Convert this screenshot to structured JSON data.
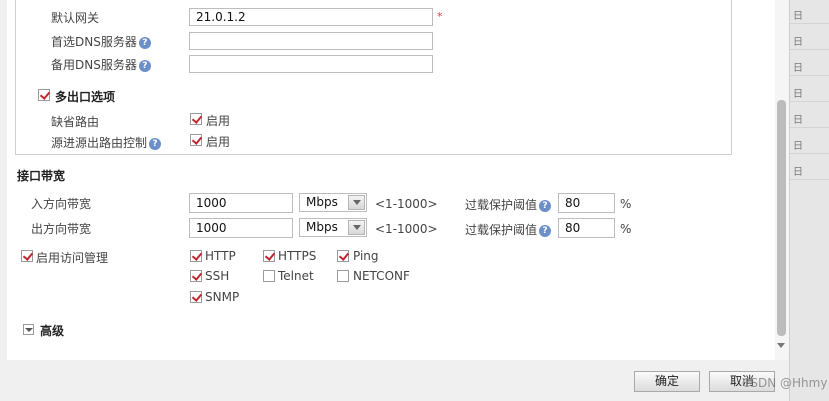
{
  "gateway": {
    "label": "默认网关",
    "value": "21.0.1.2",
    "required_mark": "*"
  },
  "dns_primary": {
    "label": "首选DNS服务器",
    "value": ""
  },
  "dns_secondary": {
    "label": "备用DNS服务器",
    "value": ""
  },
  "help_glyph": "?",
  "multi_egress": {
    "label": "多出口选项",
    "checked": true,
    "default_route": {
      "label": "缺省路由",
      "option": "启用",
      "checked": true
    },
    "source_route": {
      "label": "源进源出路由控制",
      "option": "启用",
      "checked": true
    }
  },
  "bandwidth": {
    "title": "接口带宽",
    "inbound": {
      "label": "入方向带宽",
      "value": "1000",
      "unit": "Mbps",
      "range": "<1-1000>",
      "threshold_label": "过载保护阈值",
      "threshold": "80",
      "percent": "%"
    },
    "outbound": {
      "label": "出方向带宽",
      "value": "1000",
      "unit": "Mbps",
      "range": "<1-1000>",
      "threshold_label": "过载保护阈值",
      "threshold": "80",
      "percent": "%"
    }
  },
  "access_mgmt": {
    "label": "启用访问管理",
    "checked": true,
    "protocols": [
      {
        "name": "HTTP",
        "checked": true
      },
      {
        "name": "HTTPS",
        "checked": true
      },
      {
        "name": "Ping",
        "checked": true
      },
      {
        "name": "SSH",
        "checked": true
      },
      {
        "name": "Telnet",
        "checked": false
      },
      {
        "name": "NETCONF",
        "checked": false
      },
      {
        "name": "SNMP",
        "checked": true
      }
    ]
  },
  "advanced": {
    "label": "高级"
  },
  "buttons": {
    "ok": "确定",
    "cancel": "取消"
  },
  "background_rows": [
    "日",
    "日",
    "日",
    "日",
    "日",
    "日",
    "日"
  ],
  "watermark": "CSDN @Hhmy"
}
